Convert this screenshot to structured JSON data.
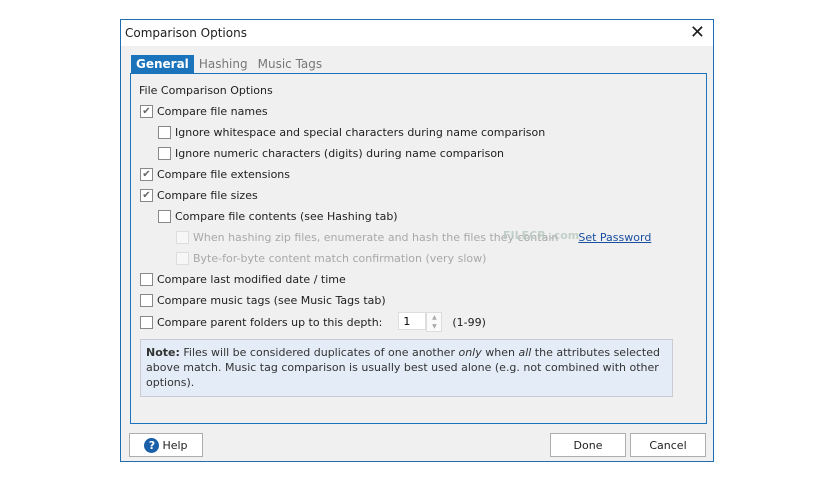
{
  "dialog": {
    "title": "Comparison Options",
    "close_icon": "close-icon"
  },
  "tabs": [
    {
      "label": "General",
      "active": true
    },
    {
      "label": "Hashing"
    },
    {
      "label": "Music Tags"
    }
  ],
  "section_title": "File Comparison Options",
  "options": {
    "names": {
      "label": "Compare file names",
      "checked": true
    },
    "whitespace": {
      "label": "Ignore whitespace and special characters during name comparison",
      "checked": false
    },
    "numeric": {
      "label": "Ignore numeric characters (digits) during name comparison",
      "checked": false
    },
    "extensions": {
      "label": "Compare file extensions",
      "checked": true
    },
    "sizes": {
      "label": "Compare file sizes",
      "checked": true
    },
    "contents": {
      "label": "Compare file contents (see Hashing tab)",
      "checked": false
    },
    "zip": {
      "label": "When hashing zip files, enumerate and hash the files they contain",
      "checked": false,
      "disabled": true
    },
    "byte": {
      "label": "Byte-for-byte content match confirmation (very slow)",
      "checked": false,
      "disabled": true
    },
    "modified": {
      "label": "Compare last modified date / time",
      "checked": false
    },
    "music": {
      "label": "Compare music tags (see Music Tags tab)",
      "checked": false
    },
    "parent": {
      "label": "Compare parent folders up to this depth:",
      "checked": false,
      "depth": "1",
      "range": "(1-99)"
    }
  },
  "set_password": "Set Password",
  "watermark": "FILECR .com",
  "note": {
    "bold": "Note:",
    "t1": " Files will be considered duplicates of one another ",
    "only": "only",
    "t2": " when ",
    "all": "all",
    "t3": " the attributes selected above match. Music tag comparison is usually best used alone (e.g. not combined with other options)."
  },
  "buttons": {
    "help": "Help",
    "done": "Done",
    "cancel": "Cancel"
  }
}
